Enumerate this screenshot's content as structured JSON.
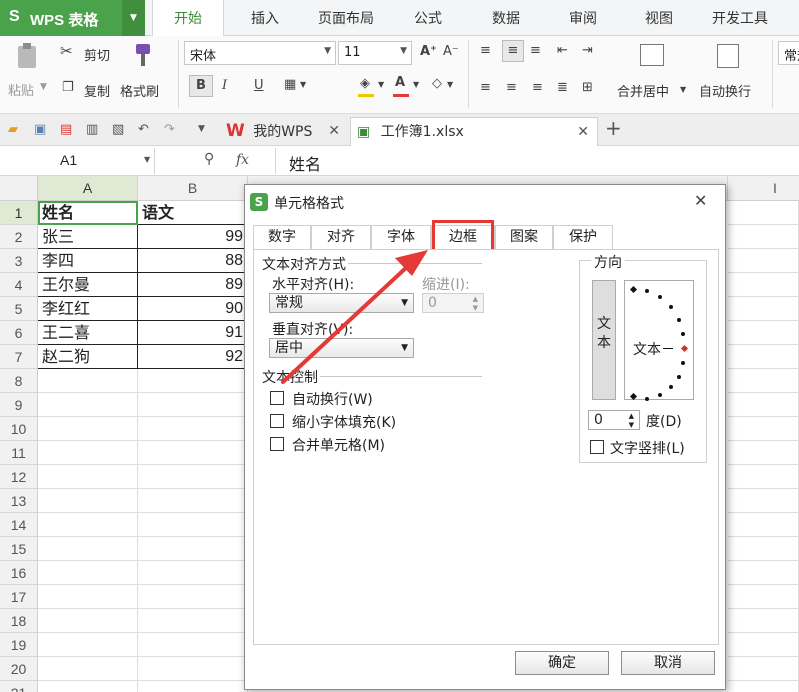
{
  "app": {
    "logo_s": "S",
    "logo_text": "WPS 表格",
    "menu_tabs": [
      "开始",
      "插入",
      "页面布局",
      "公式",
      "数据",
      "审阅",
      "视图",
      "开发工具"
    ]
  },
  "ribbon": {
    "paste": "粘贴",
    "cut": "剪切",
    "copy": "复制",
    "format_painter": "格式刷",
    "font_name": "宋体",
    "font_size": "11",
    "bold": "B",
    "italic": "I",
    "underline": "U",
    "merge_center": "合并居中",
    "wrap_text": "自动换行",
    "regular": "常规"
  },
  "docbar": {
    "tab_wps": "我的WPS",
    "tab_file": "工作簿1.xlsx"
  },
  "formula": {
    "name_box": "A1",
    "fx": "fx",
    "content": "姓名"
  },
  "sheet": {
    "columns": [
      "A",
      "B",
      "I"
    ],
    "rows": [
      "1",
      "2",
      "3",
      "4",
      "5",
      "6",
      "7",
      "8",
      "9",
      "10",
      "11",
      "12",
      "13",
      "14",
      "15",
      "16",
      "17",
      "18",
      "19",
      "20",
      "21"
    ],
    "col_a": [
      "姓名",
      "张三",
      "李四",
      "王尔曼",
      "李红红",
      "王二喜",
      "赵二狗"
    ],
    "col_b": [
      "语文",
      "99",
      "88",
      "89",
      "90",
      "91",
      "92"
    ]
  },
  "dialog": {
    "title": "单元格格式",
    "tabs": [
      "数字",
      "对齐",
      "字体",
      "边框",
      "图案",
      "保护"
    ],
    "text_align_section": "文本对齐方式",
    "horizontal_label": "水平对齐(H):",
    "horizontal_value": "常规",
    "indent_label": "缩进(I):",
    "indent_value": "0",
    "vertical_label": "垂直对齐(V):",
    "vertical_value": "居中",
    "text_control_section": "文本控制",
    "wrap_label": "自动换行(W)",
    "shrink_label": "缩小字体填充(K)",
    "merge_label": "合并单元格(M)",
    "direction_section": "方向",
    "vertical_text": "文本",
    "orientation_text": "文本",
    "degree_value": "0",
    "degree_label": "度(D)",
    "vertical_stack_label": "文字竖排(L)",
    "ok": "确定",
    "cancel": "取消"
  },
  "colors": {
    "accent_green": "#4aa24a",
    "highlight_red": "#e53935"
  }
}
